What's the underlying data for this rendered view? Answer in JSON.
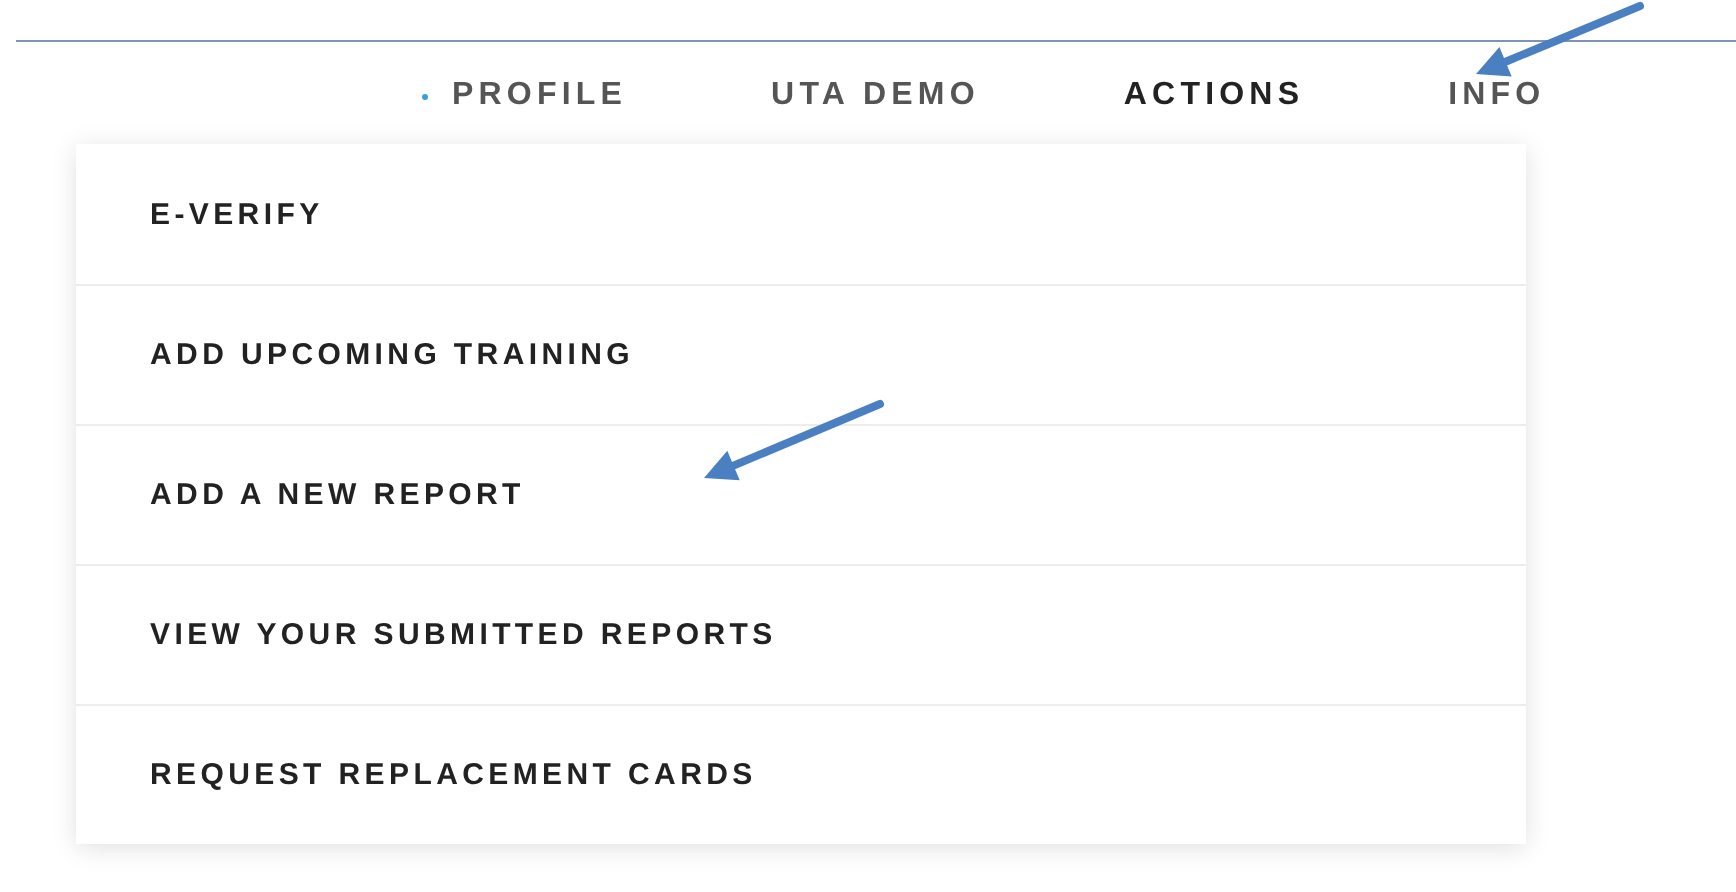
{
  "nav": [
    {
      "label": "PROFILE",
      "selected": false
    },
    {
      "label": "UTA DEMO",
      "selected": false
    },
    {
      "label": "ACTIONS",
      "selected": true
    },
    {
      "label": "INFO",
      "selected": false
    }
  ],
  "menu": [
    {
      "label": "E-VERIFY"
    },
    {
      "label": "ADD UPCOMING TRAINING"
    },
    {
      "label": "ADD A NEW REPORT"
    },
    {
      "label": "VIEW YOUR SUBMITTED REPORTS"
    },
    {
      "label": "REQUEST REPLACEMENT CARDS"
    }
  ]
}
